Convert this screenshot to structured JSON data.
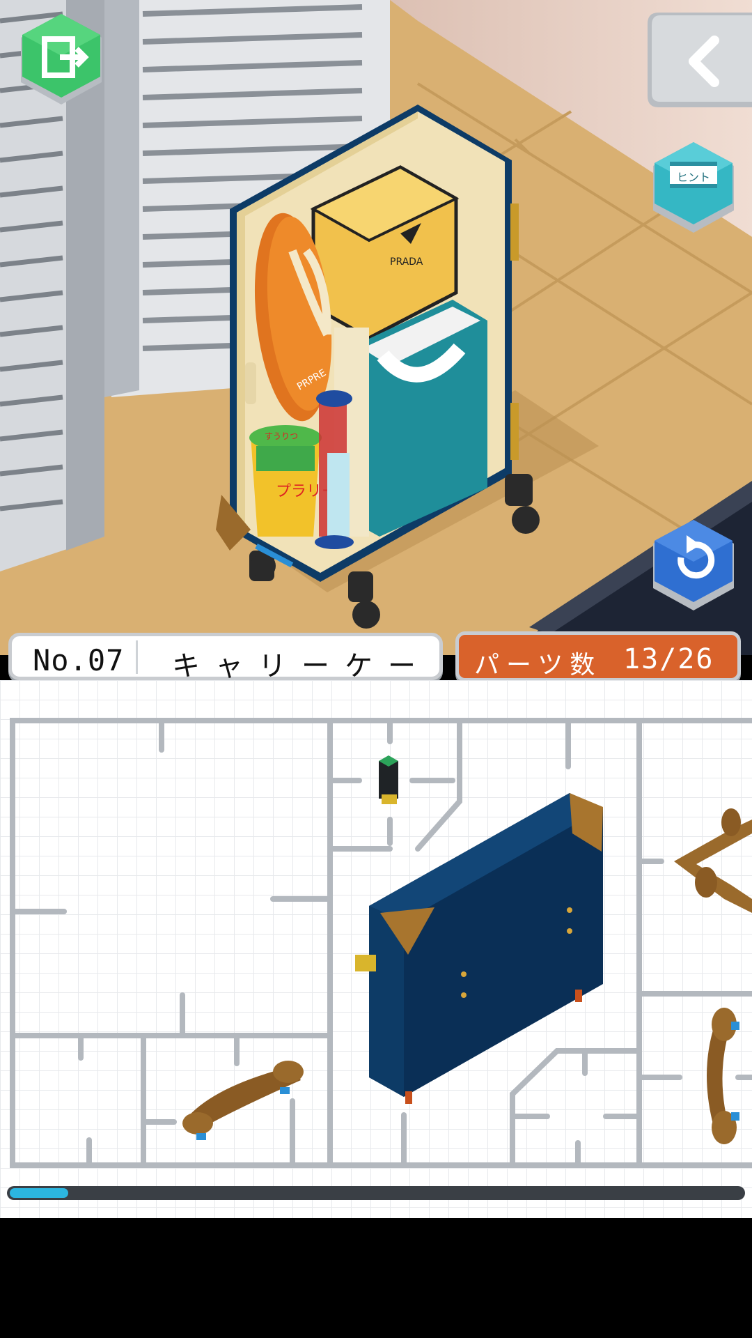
{
  "level": {
    "number_label": "No.07",
    "name": "キャリーケース"
  },
  "parts": {
    "label": "パーツ数",
    "current": 13,
    "total": 26,
    "count_text": "13/26"
  },
  "buttons": {
    "exit": {
      "icon": "exit-door-icon",
      "color": "#3cc46a"
    },
    "back": {
      "icon": "chevron-left-icon",
      "color": "#c9ccd0"
    },
    "hint": {
      "icon": "hint-video-icon",
      "label": "ヒント",
      "color": "#35b7c4"
    },
    "undo": {
      "icon": "undo-arrow-icon",
      "color": "#2f6fd1"
    }
  },
  "model_items": {
    "pouch_logo": "PRADA",
    "snack_label": "プラリー",
    "snack_top": "すうりつ",
    "sandal_logo": "PRPRE"
  },
  "tray_progress": 0.08,
  "colors": {
    "case_blue": "#0d3b66",
    "leather": "#9a6a2c",
    "parts_plate": "#d9622b",
    "progress": "#2cb6e0"
  }
}
